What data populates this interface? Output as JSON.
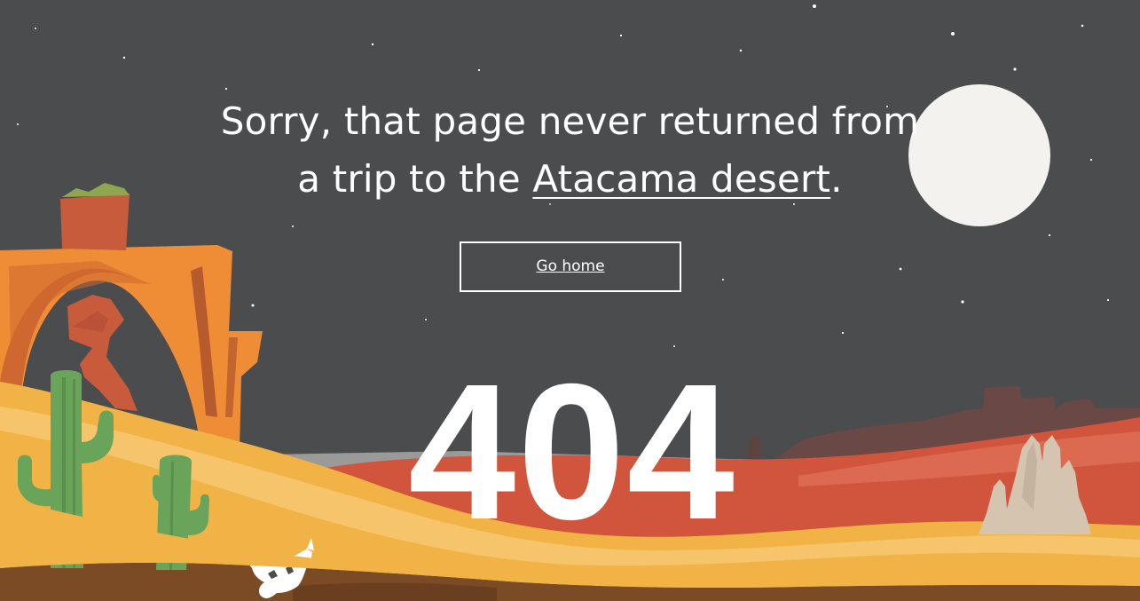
{
  "page": {
    "message_prefix": "Sorry, that page never returned from a trip to the ",
    "message_link": "Atacama desert",
    "message_suffix": ".",
    "button_label": "Go home",
    "error_code": "404"
  },
  "icons": {
    "moon": "moon-icon",
    "cactus": "cactus-icon",
    "skull": "cow-skull-icon",
    "rock_arch": "rock-arch-icon"
  },
  "colors": {
    "sky": "#4b4c4e",
    "moon": "#f3f2ef",
    "dune_yellow": "#f2b346",
    "dune_pale": "#f4be62",
    "red_ground": "#d1553d",
    "rock_orange": "#e8822f",
    "cactus_green": "#6aa45a",
    "dirt_brown": "#7a4b24"
  }
}
